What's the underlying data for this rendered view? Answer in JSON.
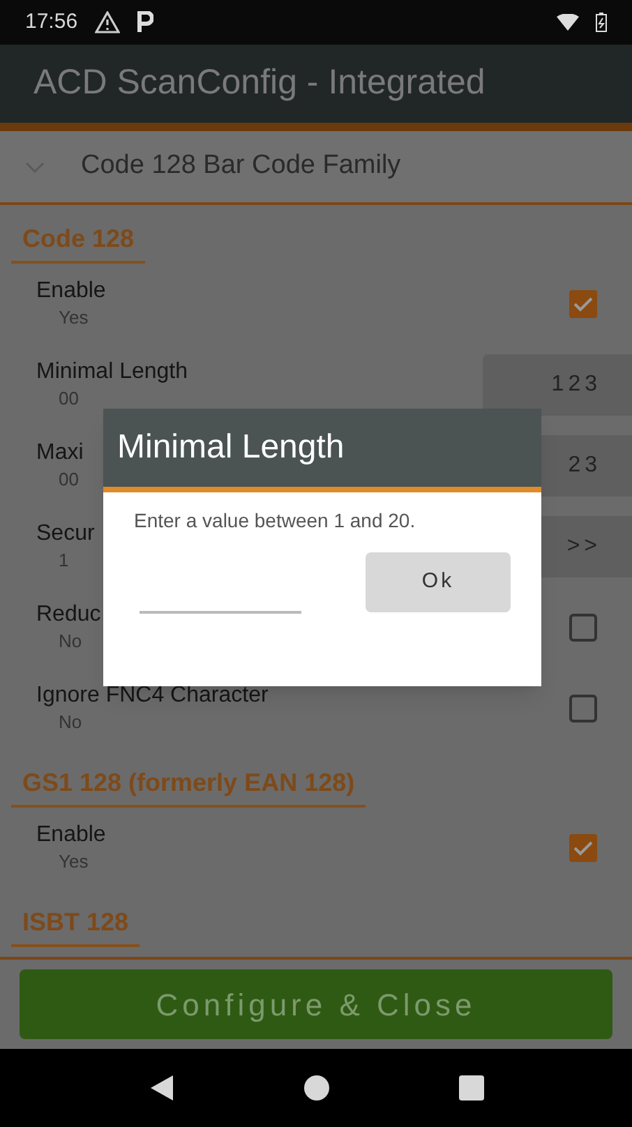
{
  "status_bar": {
    "time": "17:56"
  },
  "app_bar": {
    "title": "ACD ScanConfig - Integrated"
  },
  "family": {
    "label": "Code 128 Bar Code Family",
    "expanded": true
  },
  "sections": [
    {
      "title": "Code 128",
      "rows": [
        {
          "kind": "checkbox",
          "label": "Enable",
          "value": "Yes",
          "checked": true
        },
        {
          "kind": "number",
          "label": "Minimal Length",
          "value": "00",
          "field": "123"
        },
        {
          "kind": "number",
          "label": "Maxi",
          "value": "00",
          "field": "23"
        },
        {
          "kind": "picker",
          "label": "Secur",
          "value": "1",
          "field": ">>"
        },
        {
          "kind": "checkbox",
          "label": "Reduc",
          "value": "No",
          "checked": false
        },
        {
          "kind": "checkbox",
          "label": "Ignore FNC4 Character",
          "value": "No",
          "checked": false
        }
      ]
    },
    {
      "title": "GS1 128 (formerly EAN 128)",
      "rows": [
        {
          "kind": "checkbox",
          "label": "Enable",
          "value": "Yes",
          "checked": true
        }
      ]
    },
    {
      "title": "ISBT 128"
    }
  ],
  "dialog": {
    "title": "Minimal Length",
    "message": "Enter a value between 1 and 20.",
    "button": "Ok"
  },
  "configure_button": "Configure & Close"
}
